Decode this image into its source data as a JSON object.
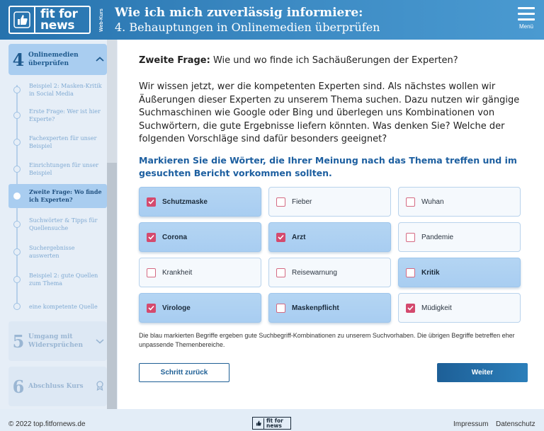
{
  "header": {
    "logo_text_line1": "fit for",
    "logo_text_line2": "news",
    "webkurs": "Web-Kurs",
    "title_line1": "Wie ich mich zuverlässig informiere:",
    "title_line2": "4. Behauptungen in Onlinemedien überprüfen",
    "menu_label": "Menü"
  },
  "sidebar": {
    "section4": {
      "number": "4",
      "title": "Onlinemedien überprüfen"
    },
    "steps": [
      {
        "label": "Beispiel 2: Masken-Kritik in Social Media",
        "active": false
      },
      {
        "label": "Erste Frage: Wer ist hier Experte?",
        "active": false
      },
      {
        "label": "Fachexperten für unser Beispiel",
        "active": false
      },
      {
        "label": "Einrichtungen für unser Beispiel",
        "active": false
      },
      {
        "label": "Zweite Frage: Wo finde ich Experten?",
        "active": true
      },
      {
        "label": "Suchwörter & Tipps für Quellensuche",
        "active": false
      },
      {
        "label": "Suchergebnisse auswerten",
        "active": false
      },
      {
        "label": "Beispiel 2: gute Quellen zum Thema",
        "active": false
      },
      {
        "label": "eine kompetente Quelle",
        "active": false
      }
    ],
    "section5": {
      "number": "5",
      "title": "Umgang mit Widersprüchen"
    },
    "section6": {
      "number": "6",
      "title": "Abschluss Kurs"
    }
  },
  "main": {
    "question_bold": "Zweite Frage:",
    "question_rest": " Wie und wo finde ich Sachäußerungen der Experten?",
    "body": "Wir wissen jetzt, wer die kompetenten Experten sind. Als nächstes wollen wir Äußerungen dieser Experten zu unserem Thema suchen. Dazu nutzen wir gängige Suchmaschinen wie Google oder Bing und überlegen uns Kombinationen von Suchwörtern, die gute Ergebnisse liefern könnten. Was denken Sie? Welche der folgenden Vorschläge sind dafür besonders geeignet?",
    "task": "Markieren Sie die Wörter, die Ihrer Meinung nach das Thema treffen und im gesuchten Bericht vorkommen sollten.",
    "options": [
      {
        "label": "Schutzmaske",
        "checked": true,
        "highlighted": true
      },
      {
        "label": "Fieber",
        "checked": false,
        "highlighted": false
      },
      {
        "label": "Wuhan",
        "checked": false,
        "highlighted": false
      },
      {
        "label": "Corona",
        "checked": true,
        "highlighted": true
      },
      {
        "label": "Arzt",
        "checked": true,
        "highlighted": true
      },
      {
        "label": "Pandemie",
        "checked": false,
        "highlighted": false
      },
      {
        "label": "Krankheit",
        "checked": false,
        "highlighted": false
      },
      {
        "label": "Reisewarnung",
        "checked": false,
        "highlighted": false
      },
      {
        "label": "Kritik",
        "checked": false,
        "highlighted": true
      },
      {
        "label": "Virologe",
        "checked": true,
        "highlighted": true
      },
      {
        "label": "Maskenpflicht",
        "checked": false,
        "highlighted": true
      },
      {
        "label": "Müdigkeit",
        "checked": true,
        "highlighted": false
      }
    ],
    "hint": "Die blau markierten Begriffe ergeben gute Suchbegriff-Kombinationen zu unserem Suchvorhaben. Die übrigen Begriffe betreffen eher unpassende Themenbereiche.",
    "back_label": "Schritt zurück",
    "next_label": "Weiter"
  },
  "footer": {
    "copyright": "© 2022 top.fitfornews.de",
    "logo_line1": "fit for",
    "logo_line2": "news",
    "impressum": "Impressum",
    "datenschutz": "Datenschutz"
  },
  "colors": {
    "header_blue": "#2672ad",
    "selected_blue": "#a9cdf0",
    "checkbox_pink": "#d44a6e",
    "task_blue": "#1d5fa0"
  }
}
